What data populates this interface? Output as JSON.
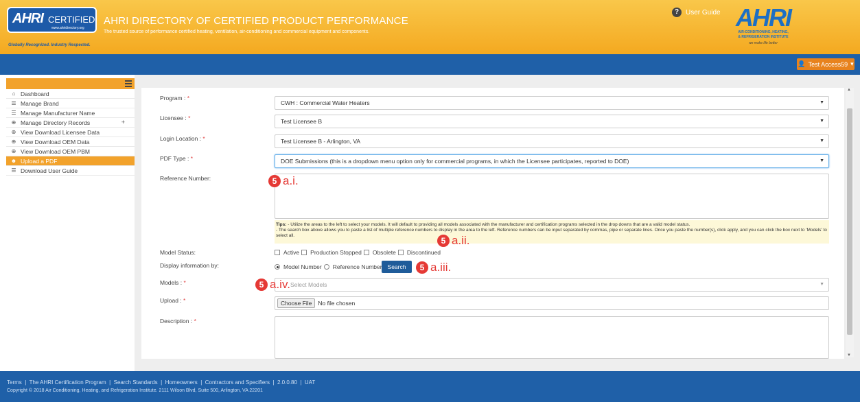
{
  "header": {
    "logo_text": "AHRI",
    "logo_certified": "CERTIFIED",
    "logo_url": "www.ahridirectory.org",
    "logo_tagline": "Globally Recognized. Industry Respected.",
    "title": "AHRI DIRECTORY OF CERTIFIED PRODUCT PERFORMANCE",
    "subtitle": "The trusted source of performance certified heating, ventilation, air-conditioning and commercial equipment and components.",
    "user_guide": "User Guide",
    "brand_name": "AHRI",
    "brand_line1": "AIR-CONDITIONING, HEATING,",
    "brand_line2": "& REFRIGERATION INSTITUTE",
    "brand_tagline": "we make life better"
  },
  "user": {
    "label": "Test Access59"
  },
  "sidebar": {
    "items": [
      {
        "label": "Dashboard",
        "icon": "home-icon"
      },
      {
        "label": "Manage Brand",
        "icon": "list-icon"
      },
      {
        "label": "Manage Manufacturer Name",
        "icon": "list-icon"
      },
      {
        "label": "Manage Directory Records",
        "icon": "plus-circle-icon"
      },
      {
        "label": "View Download Licensee Data",
        "icon": "plus-circle-icon"
      },
      {
        "label": "View Download OEM Data",
        "icon": "plus-circle-icon"
      },
      {
        "label": "View Download OEM PBM",
        "icon": "plus-circle-icon"
      },
      {
        "label": "Upload a PDF",
        "icon": "user-icon"
      },
      {
        "label": "Download User Guide",
        "icon": "list-icon"
      }
    ]
  },
  "form": {
    "program_label": "Program :",
    "program_value": "CWH : Commercial Water Heaters",
    "licensee_label": "Licensee :",
    "licensee_value": "Test Licensee B",
    "location_label": "Login Location :",
    "location_value": "Test Licensee B - Arlington, VA",
    "pdf_type_label": "PDF Type :",
    "pdf_type_value": "DOE Submissions (this is a dropdown menu option only for commercial programs, in which the Licensee participates, reported to DOE)",
    "reference_label": "Reference Number:",
    "tips_title": "Tips:",
    "tips_line1": "- Utilize the areas to the left to select your models. It will default to providing all models associated with the manufacturer and certification programs selected in the drop downs that are a valid model status.",
    "tips_line2": "- The search box above allows you to paste a list of multiple reference numbers to display in the area to the left. Reference numbers can be input separated by commas, pipe or separate lines. Once you paste the number(s), click apply, and you can click the box next to 'Models' to select all.",
    "status_label": "Model Status:",
    "status_options": [
      "Active",
      "Production Stopped",
      "Obsolete",
      "Discontinued"
    ],
    "display_label": "Display information by:",
    "display_options": [
      "Model Number",
      "Reference Number"
    ],
    "search_button": "Search",
    "models_label": "Models :",
    "models_placeholder": "Select Models",
    "upload_label": "Upload :",
    "choose_file": "Choose File",
    "no_file": "No file chosen",
    "description_label": "Description :",
    "required_mark": "*"
  },
  "annotations": [
    {
      "num": "5",
      "text": "a.i."
    },
    {
      "num": "5",
      "text": "a.ii."
    },
    {
      "num": "5",
      "text": "a.iii."
    },
    {
      "num": "5",
      "text": "a.iv."
    }
  ],
  "footer": {
    "links": [
      "Terms",
      "The AHRI Certification Program",
      "Search Standards",
      "Homeowners",
      "Contractors and Specifiers",
      "2.0.0.80",
      "UAT"
    ],
    "copyright": "Copyright © 2018 Air Conditioning, Heating, and Refrigeration Institute. 2111 Wilson Blvd, Suite 500, Arlington, VA 22201"
  },
  "colors": {
    "accent": "#f2a22b",
    "brand_blue": "#1f60a8",
    "annotation": "#e53935"
  }
}
